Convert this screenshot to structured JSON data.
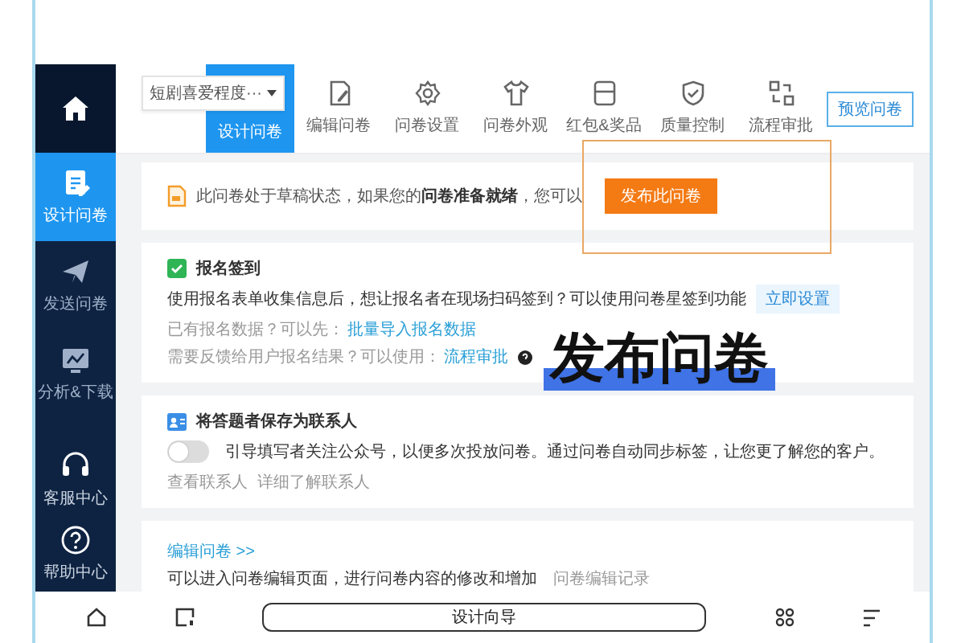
{
  "sidebar": {
    "items": [
      {
        "label": "设计问卷",
        "selected": true
      },
      {
        "label": "发送问卷",
        "selected": false
      },
      {
        "label": "分析&下载",
        "selected": false
      }
    ],
    "footer_items": [
      {
        "label": "客服中心"
      },
      {
        "label": "帮助中心"
      }
    ]
  },
  "toolbar": {
    "survey_select": {
      "value": "短剧喜爱程度···"
    },
    "tabs": [
      {
        "label": "设计问卷",
        "selected": true
      },
      {
        "label": "编辑问卷",
        "selected": false
      },
      {
        "label": "问卷设置",
        "selected": false
      },
      {
        "label": "问卷外观",
        "selected": false
      },
      {
        "label": "红包&奖品",
        "selected": false
      },
      {
        "label": "质量控制",
        "selected": false
      },
      {
        "label": "流程审批",
        "selected": false
      }
    ],
    "preview_button": "预览问卷"
  },
  "notice": {
    "text": "此问卷处于草稿状态，如果您的**问卷准备就绪**，您可以",
    "button": "发布此问卷"
  },
  "signin": {
    "title": "报名签到",
    "description": "使用报名表单收集信息后，想让报名者在现场扫码签到？可以使用问卷星签到功能",
    "setup_button": "立即设置",
    "lines": [
      {
        "text": "已有报名数据？可以先：",
        "link": "批量导入报名数据"
      },
      {
        "text": "需要反馈给用户报名结果？可以使用：",
        "link": "流程审批"
      }
    ]
  },
  "contacts": {
    "title": "将答题者保存为联系人",
    "toggle": {
      "on": false
    },
    "description": "引导填写者关注公众号，以便多次投放问卷。通过问卷自动同步标签，让您更了解您的客户。",
    "links": [
      "查看联系人",
      "详细了解联系人"
    ]
  },
  "edit": {
    "link": "编辑问卷 >>",
    "description": "可以进入问卷编辑页面，进行问卷内容的修改和增加",
    "history_link": "问卷编辑记录"
  },
  "overlay": {
    "caption": "发布问卷"
  },
  "bottom_bar": {
    "guide_button": "设计向导"
  }
}
